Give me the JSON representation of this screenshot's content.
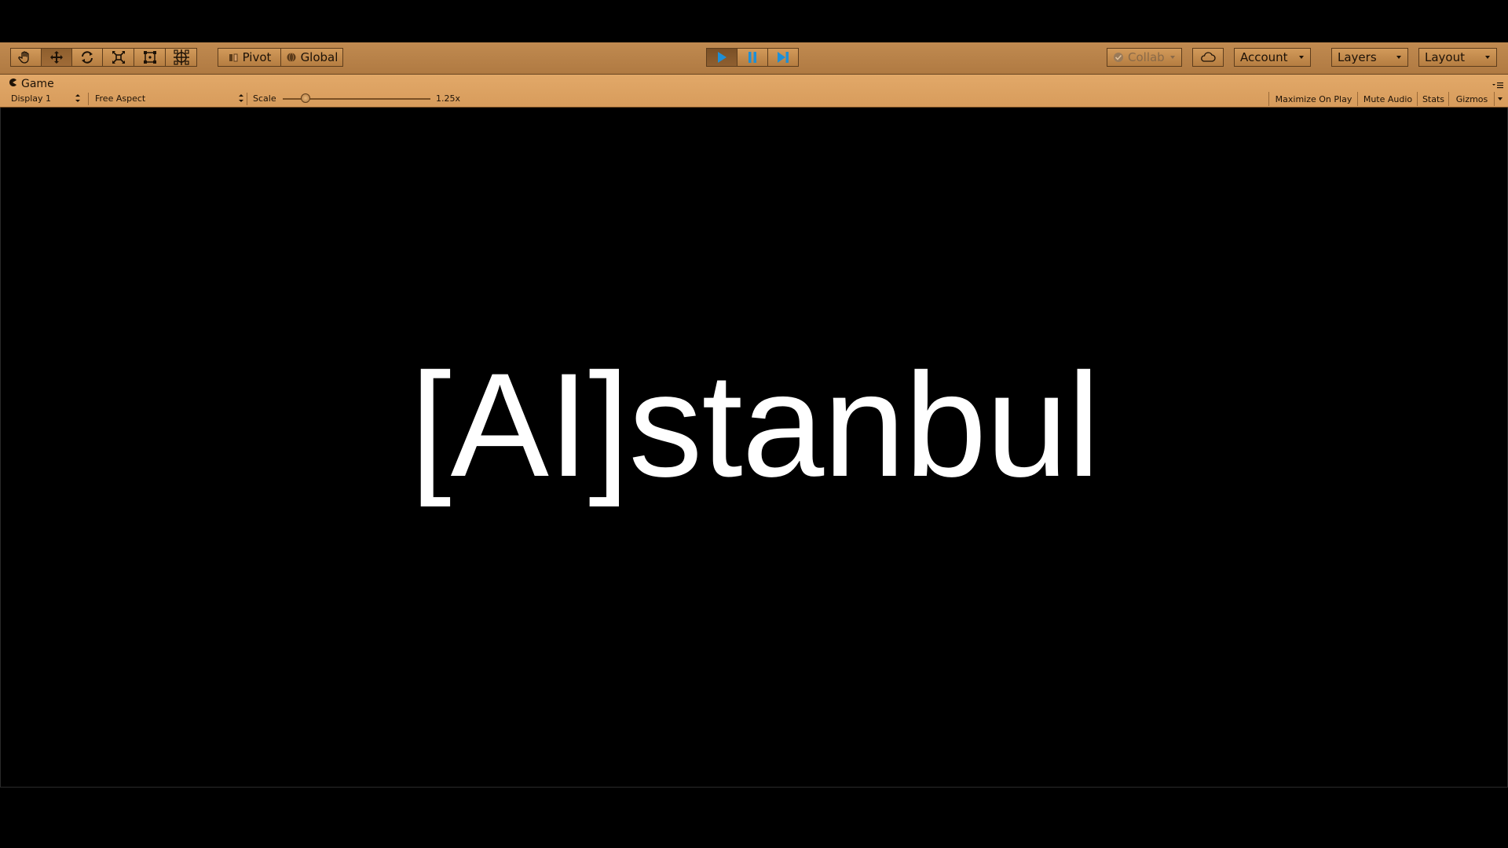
{
  "toolbar": {
    "transform_tools": [
      {
        "name": "hand-tool-button",
        "icon": "hand-icon"
      },
      {
        "name": "move-tool-button",
        "icon": "move-arrows-icon"
      },
      {
        "name": "rotate-tool-button",
        "icon": "rotate-icon"
      },
      {
        "name": "scale-tool-button",
        "icon": "scale-icon"
      },
      {
        "name": "rect-tool-button",
        "icon": "rect-transform-icon"
      },
      {
        "name": "transform-tool-button",
        "icon": "transform-icon"
      }
    ],
    "pivot_label": "Pivot",
    "global_label": "Global",
    "play_icon": "play-icon",
    "pause_icon": "pause-icon",
    "step_icon": "step-icon",
    "collab_label": "Collab",
    "cloud_icon": "cloud-icon",
    "account_label": "Account",
    "layers_label": "Layers",
    "layout_label": "Layout"
  },
  "game_window": {
    "tab_label": "Game",
    "display_label": "Display 1",
    "aspect_label": "Free Aspect",
    "scale_label": "Scale",
    "scale_value": "1.25x",
    "scale_slider_fraction": 0.13,
    "maximize_label": "Maximize On Play",
    "mute_label": "Mute Audio",
    "stats_label": "Stats",
    "gizmos_label": "Gizmos"
  },
  "game_view": {
    "title": "[AI]stanbul"
  },
  "colors": {
    "toolbar_bg": "#b57d41",
    "header_bg": "#dca160",
    "accent_play": "#1e8fd6"
  }
}
